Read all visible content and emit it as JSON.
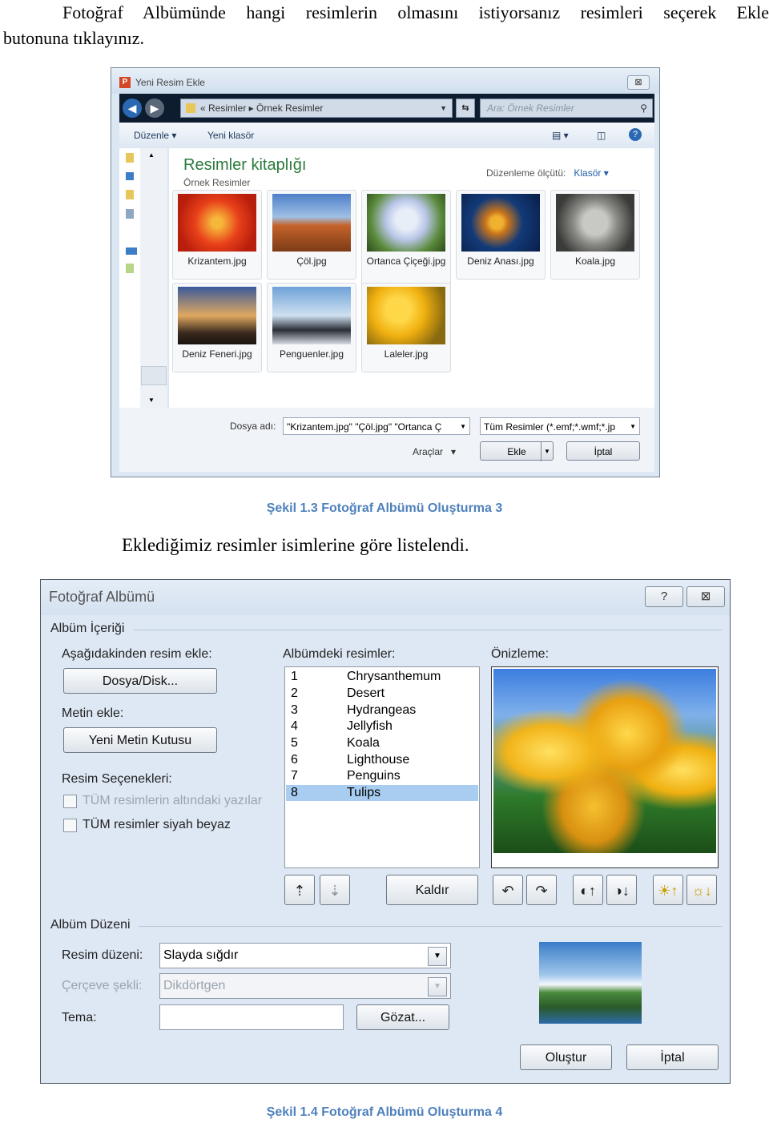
{
  "paragraph1": {
    "line1": "Fotoğraf Albümünde hangi resimlerin olmasını istiyorsanız resimleri seçerek Ekle",
    "line2": "butonuna tıklayınız."
  },
  "dialog1": {
    "title": "Yeni Resim Ekle",
    "close": "⊠",
    "address": "« Resimler ▸ Örnek Resimler",
    "search_placeholder": "Ara: Örnek Resimler",
    "toolbar": {
      "organize": "Düzenle",
      "new_folder": "Yeni klasör"
    },
    "library_title": "Resimler kitaplığı",
    "library_subtitle": "Örnek Resimler",
    "arrange_label": "Düzenleme ölçütü:",
    "arrange_value": "Klasör",
    "thumbnails": [
      {
        "name": "Krizantem.jpg"
      },
      {
        "name": "Çöl.jpg"
      },
      {
        "name": "Ortanca Çiçeği.jpg"
      },
      {
        "name": "Deniz Anası.jpg"
      },
      {
        "name": "Koala.jpg"
      },
      {
        "name": "Deniz Feneri.jpg"
      },
      {
        "name": "Penguenler.jpg"
      },
      {
        "name": "Laleler.jpg"
      }
    ],
    "filename_label": "Dosya adı:",
    "filename_value": "\"Krizantem.jpg\" \"Çöl.jpg\" \"Ortanca Ç",
    "filetype_value": "Tüm Resimler (*.emf;*.wmf;*.jp",
    "tools_label": "Araçlar",
    "add_button": "Ekle",
    "cancel_button": "İptal"
  },
  "caption1": "Şekil 1.3 Fotoğraf Albümü Oluşturma 3",
  "paragraph2": "Eklediğimiz resimler isimlerine göre listelendi.",
  "dialog2": {
    "title": "Fotoğraf Albümü",
    "help": "?",
    "close": "⊠",
    "album_content": "Albüm İçeriği",
    "insert_from": "Aşağıdakinden resim ekle:",
    "file_disk_button": "Dosya/Disk...",
    "insert_text": "Metin ekle:",
    "new_textbox_button": "Yeni Metin Kutusu",
    "picture_options": "Resim Seçenekleri:",
    "option_captions": "TÜM resimlerin altındaki yazılar",
    "option_bw": "TÜM resimler siyah beyaz",
    "pictures_in_album": "Albümdeki resimler:",
    "pictures": [
      {
        "n": "1",
        "name": "Chrysanthemum"
      },
      {
        "n": "2",
        "name": "Desert"
      },
      {
        "n": "3",
        "name": "Hydrangeas"
      },
      {
        "n": "4",
        "name": "Jellyfish"
      },
      {
        "n": "5",
        "name": "Koala"
      },
      {
        "n": "6",
        "name": "Lighthouse"
      },
      {
        "n": "7",
        "name": "Penguins"
      },
      {
        "n": "8",
        "name": "Tulips"
      }
    ],
    "selected_index": 8,
    "preview_label": "Önizleme:",
    "remove_button": "Kaldır",
    "album_layout": "Albüm Düzeni",
    "picture_layout_label": "Resim düzeni:",
    "picture_layout_value": "Slayda sığdır",
    "frame_shape_label": "Çerçeve şekli:",
    "frame_shape_value": "Dikdörtgen",
    "theme_label": "Tema:",
    "theme_value": "",
    "browse_button": "Gözat...",
    "create_button": "Oluştur",
    "cancel_button": "İptal"
  },
  "caption2": "Şekil 1.4 Fotoğraf Albümü Oluşturma 4"
}
